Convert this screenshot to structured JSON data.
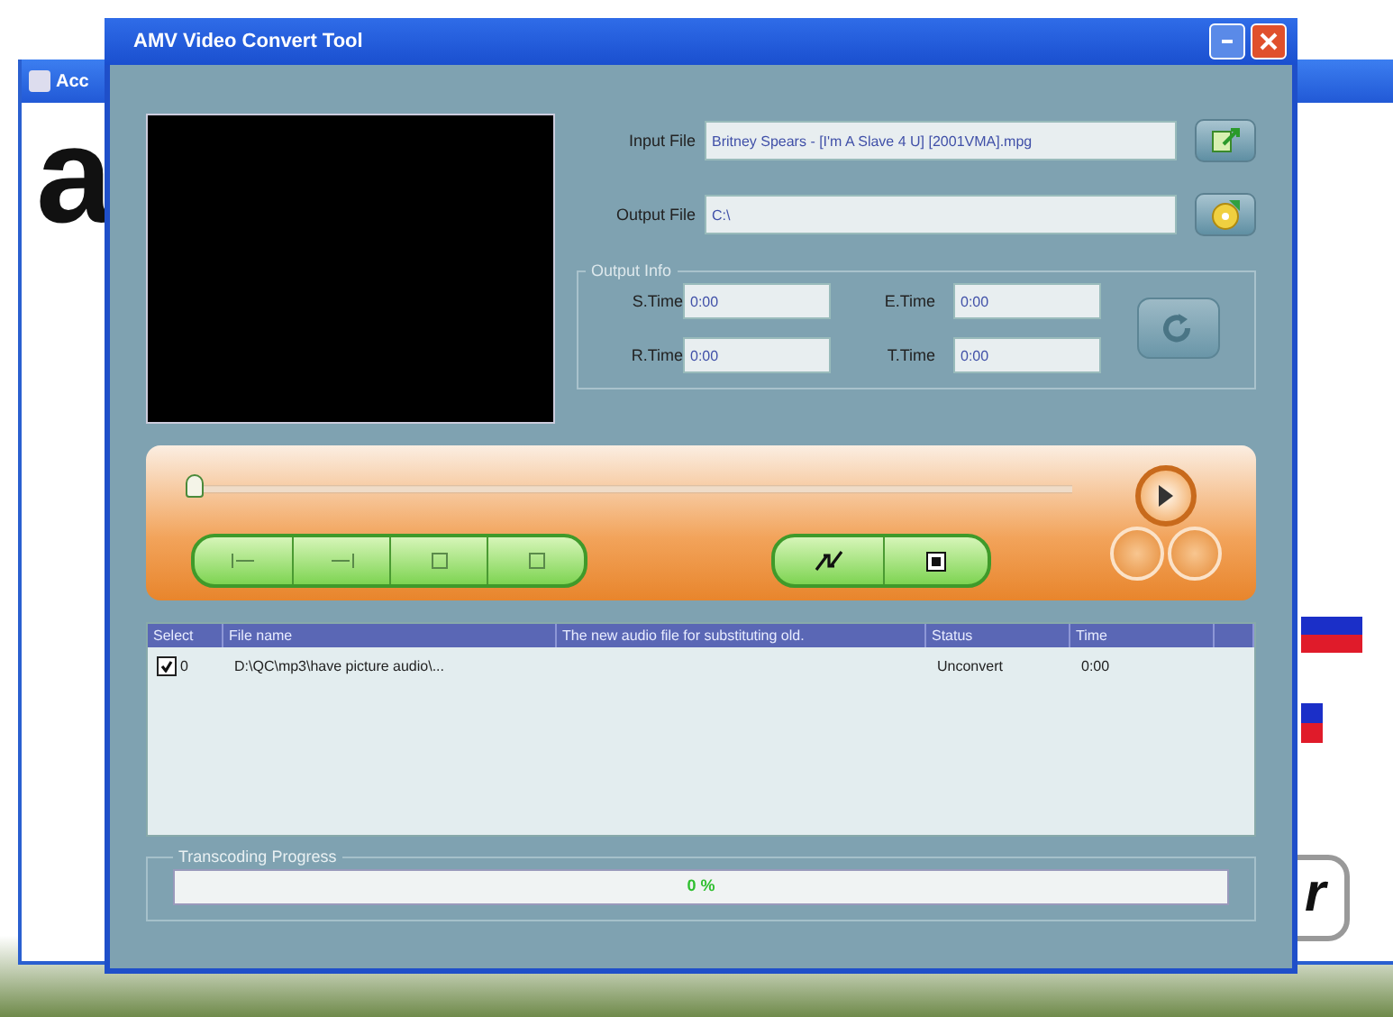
{
  "background_window": {
    "title": "Acc",
    "letters": [
      "a",
      "r"
    ]
  },
  "window": {
    "title": "AMV Video Convert Tool"
  },
  "files": [
    {
      "label": "Input File",
      "value": "Britney Spears - [I'm A Slave 4 U] [2001VMA].mpg",
      "kind": "open"
    },
    {
      "label": "Output File",
      "value": "C:\\",
      "kind": "folder"
    }
  ],
  "output_info": {
    "title": "Output Info",
    "fields": [
      {
        "label": "S.Time",
        "value": "0:00"
      },
      {
        "label": "E.Time",
        "value": "0:00"
      },
      {
        "label": "R.Time",
        "value": "0:00"
      },
      {
        "label": "T.Time",
        "value": "0:00"
      }
    ]
  },
  "player": {
    "level": 0
  },
  "table": {
    "columns": [
      "Select",
      "File name",
      "The new audio file for substituting old.",
      "Status",
      "Time"
    ],
    "rows": [
      {
        "checked": true,
        "index": "0",
        "file": "D:\\QC\\mp3\\have picture audio\\...",
        "status": "Unconvert",
        "time": "0:00"
      }
    ]
  },
  "progress": {
    "title": "Transcoding Progress",
    "level": 0,
    "text": "0 %"
  }
}
